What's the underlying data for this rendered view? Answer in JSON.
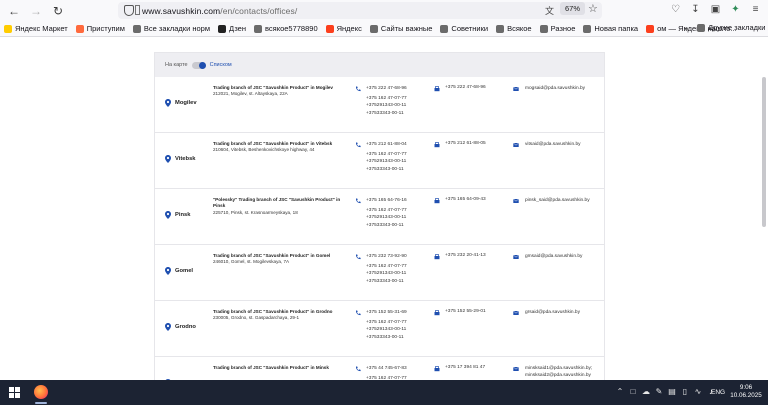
{
  "browser": {
    "url_host": "www.savushkin.com",
    "url_path": "/en/contacts/offices/",
    "zoom": "67%",
    "nav": {
      "back_icon": "back-arrow-icon",
      "forward_icon": "forward-arrow-icon",
      "reload_icon": "reload-icon"
    },
    "bookmarks": [
      {
        "label": "Яндекс Маркет",
        "color": "#ffcc00"
      },
      {
        "label": "Приступим",
        "color": "#ff6a3d"
      },
      {
        "label": "Все закладки норм",
        "color": "#6b6b6b"
      },
      {
        "label": "Дзен",
        "color": "#222222"
      },
      {
        "label": "всякое5778890",
        "color": "#6b6b6b"
      },
      {
        "label": "Яндекс",
        "color": "#fc3f1d"
      },
      {
        "label": "Сайты важные",
        "color": "#6b6b6b"
      },
      {
        "label": "Советники",
        "color": "#6b6b6b"
      },
      {
        "label": "Всякое",
        "color": "#6b6b6b"
      },
      {
        "label": "Разное",
        "color": "#6b6b6b"
      },
      {
        "label": "Новая папка",
        "color": "#6b6b6b"
      },
      {
        "label": "ом — Яндекс: нашло...",
        "color": "#fc3f1d"
      }
    ],
    "bookmarks_other": "Другие закладки"
  },
  "page": {
    "view_toggle": {
      "map_label": "На карте",
      "list_label": "Списком"
    },
    "offices": [
      {
        "city": "Mogilev",
        "name": "Trading branch of JSC \"Savushkin Product\" in Mogilev",
        "address": "212021, Mogilev, st. Altayskaya, 22A",
        "phones": [
          "+375 222 47-68-96",
          "+375 162 47-07-77",
          "+375291343-00-11",
          "+37533343-00-11"
        ],
        "fax": "+375 222 47-68-96",
        "emails": [
          "mogsaid@pda.savushkin.by"
        ]
      },
      {
        "city": "Vitebsk",
        "name": "Trading branch of JSC \"Savushkin Product\" in Vitebsk",
        "address": "210604, Vitebsk, Beshenkovichskoye highway, 44",
        "phones": [
          "+375 212 61-88-04",
          "+375 162 47-07-77",
          "+375291343-00-11",
          "+37533343-00-11"
        ],
        "fax": "+375 212 61-88-05",
        "emails": [
          "vitsaid@pda.savushkin.by"
        ]
      },
      {
        "city": "Pinsk",
        "name": "\"Polessky\" Trading branch of JSC \"Savushkin Product\" in Pinsk",
        "address": "225710, Pinsk, st. Krasnoarmeyskaya, 18",
        "phones": [
          "+375 165 64-76-16",
          "+375 162 47-07-77",
          "+375291343-00-11",
          "+37533343-00-11"
        ],
        "fax": "+375 165 64-09-43",
        "emails": [
          "pinsk_said@pda.savushkin.by"
        ]
      },
      {
        "city": "Gomel",
        "name": "Trading branch of JSC \"Savushkin Product\" in Gomel",
        "address": "246010, Gomel, st. Mogilevskaya, 7A",
        "phones": [
          "+375 232 73-92-90",
          "+375 162 47-07-77",
          "+375291343-00-11",
          "+37533343-00-11"
        ],
        "fax": "+375 232 20-41-13",
        "emails": [
          "gmsaid@pda.savushkin.by"
        ]
      },
      {
        "city": "Grodno",
        "name": "Trading branch of JSC \"Savushkin Product\" in Grodno",
        "address": "230005, Grodno, st. Gaspadarchaya, 29-1",
        "phones": [
          "+375 152 55-31-69",
          "+375 162 47-07-77",
          "+375291343-00-11",
          "+37533343-00-11"
        ],
        "fax": "+375 152 55-29-01",
        "emails": [
          "grsaid@pda.savushkin.by"
        ]
      },
      {
        "city": "Minsk",
        "name": "Trading branch of JSC \"Savushkin Product\" in Minsk",
        "address": "",
        "phones": [
          "+375 44 745-67-83",
          "+375 162 47-07-77"
        ],
        "fax": "+375 17 394 81 47",
        "emails": [
          "minsksaid1@pda.savushkin.by;",
          "minsksaid2@pda.savushkin.by"
        ]
      }
    ]
  },
  "taskbar": {
    "lang": "ENG",
    "time": "9:06",
    "date": "10.06.2025"
  }
}
